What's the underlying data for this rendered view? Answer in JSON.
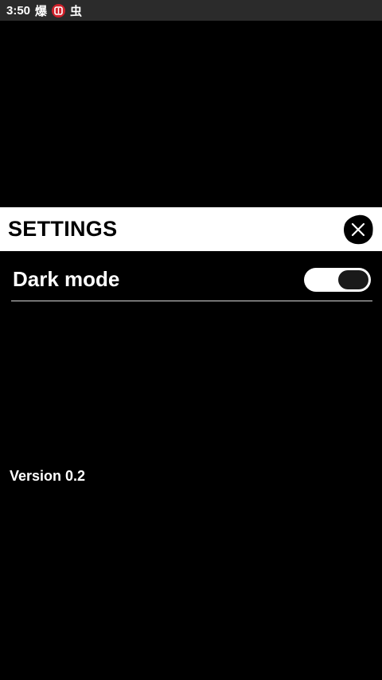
{
  "status_bar": {
    "time": "3:50",
    "icons": [
      {
        "name": "notification-app-icon",
        "glyph": "爆"
      },
      {
        "name": "notification-red-badge-icon",
        "glyph": "⛉",
        "color": "#d0202a"
      },
      {
        "name": "notification-bug-icon",
        "glyph": "虫"
      }
    ]
  },
  "settings": {
    "title": "SETTINGS",
    "close_icon": "close-icon",
    "items": [
      {
        "label": "Dark mode",
        "type": "toggle",
        "enabled": true
      }
    ]
  },
  "footer": {
    "version": "Version 0.2"
  },
  "colors": {
    "background": "#000000",
    "header_background": "#ffffff",
    "status_bar": "#2b2b2b",
    "divider": "#d8d8d8"
  }
}
